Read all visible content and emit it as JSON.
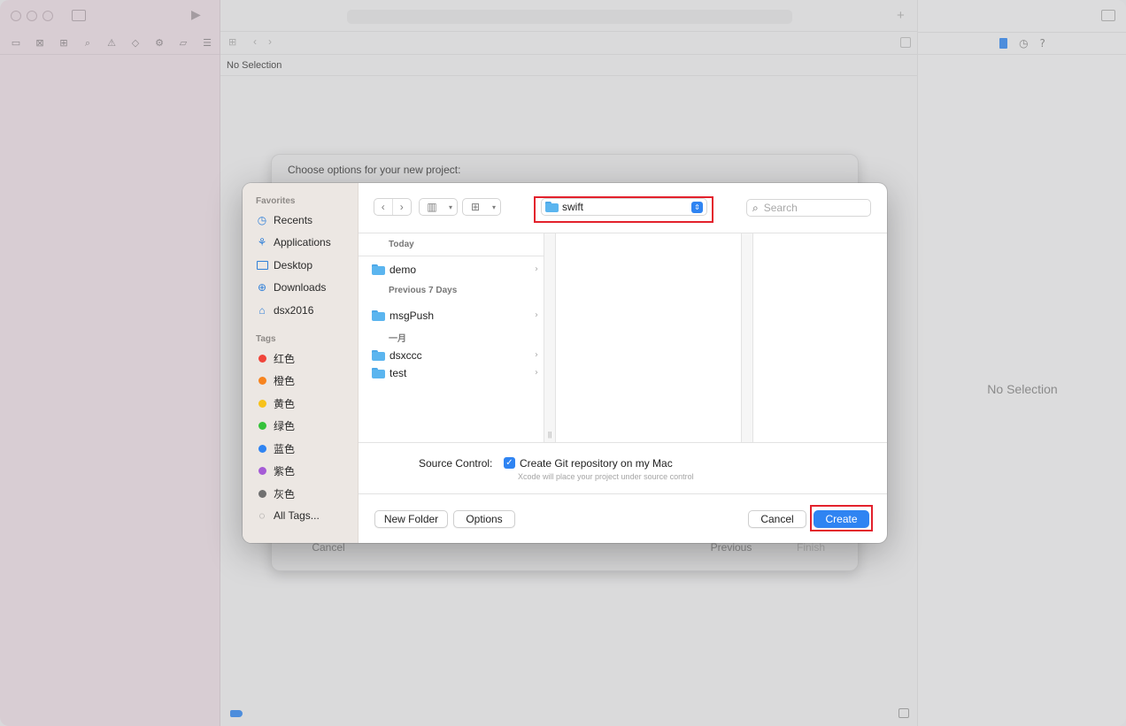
{
  "xcode": {
    "editor_placeholder": "No Selection",
    "inspector_placeholder": "No Selection"
  },
  "behind_sheet": {
    "title": "Choose options for your new project:",
    "cancel_label": "Cancel",
    "previous_label": "Previous",
    "finish_label": "Finish"
  },
  "dialog": {
    "sidebar": {
      "favorites_heading": "Favorites",
      "favorites": [
        {
          "label": "Recents",
          "icon": "clock-icon"
        },
        {
          "label": "Applications",
          "icon": "applications-icon"
        },
        {
          "label": "Desktop",
          "icon": "desktop-icon"
        },
        {
          "label": "Downloads",
          "icon": "downloads-icon"
        },
        {
          "label": "dsx2016",
          "icon": "home-icon"
        }
      ],
      "tags_heading": "Tags",
      "tags": [
        {
          "label": "红色",
          "color": "#f0443a"
        },
        {
          "label": "橙色",
          "color": "#f7841f"
        },
        {
          "label": "黄色",
          "color": "#f7c21a"
        },
        {
          "label": "绿色",
          "color": "#35c23b"
        },
        {
          "label": "蓝色",
          "color": "#2f84f2"
        },
        {
          "label": "紫色",
          "color": "#a55bd6"
        },
        {
          "label": "灰色",
          "color": "#707070"
        }
      ],
      "all_tags_label": "All Tags..."
    },
    "location": {
      "value": "swift"
    },
    "search": {
      "placeholder": "Search"
    },
    "browser": {
      "sections": [
        {
          "heading": "Today",
          "items": [
            "demo"
          ]
        },
        {
          "heading": "Previous 7 Days",
          "items": [
            "msgPush"
          ]
        },
        {
          "heading": "一月",
          "items": [
            "dsxccc",
            "test"
          ]
        }
      ]
    },
    "source_control": {
      "label": "Source Control:",
      "checkbox_label": "Create Git repository on my Mac",
      "hint": "Xcode will place your project under source control",
      "checked": true
    },
    "buttons": {
      "new_folder": "New Folder",
      "options": "Options",
      "cancel": "Cancel",
      "create": "Create"
    },
    "accent_color": "#2f84f2",
    "highlight_color": "#e3212c"
  }
}
